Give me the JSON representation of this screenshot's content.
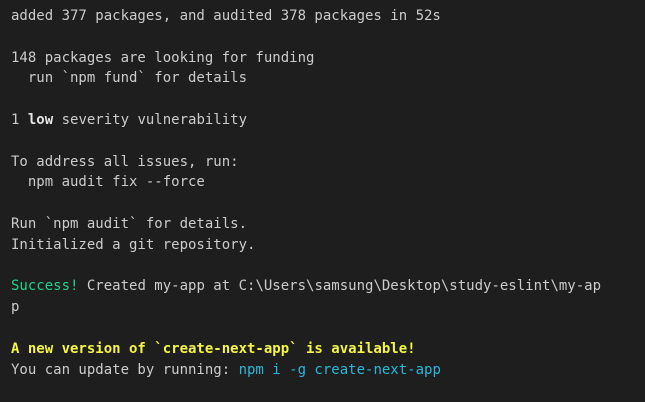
{
  "colors": {
    "background": "#1e1e1e",
    "foreground": "#cccccc",
    "success": "#23d18b",
    "warning": "#f5f543",
    "command": "#29b8db"
  },
  "lines": {
    "added": "added 377 packages, and audited 378 packages in 52s",
    "funding": "148 packages are looking for funding",
    "fund_hint": "  run `npm fund` for details",
    "vuln_count": "1 ",
    "vuln_level": "low",
    "vuln_rest": " severity vulnerability",
    "address": "To address all issues, run:",
    "fix_cmd": "  npm audit fix --force",
    "audit_hint": "Run `npm audit` for details.",
    "git_init": "Initialized a git repository.",
    "success_label": "Success!",
    "created_text": " Created my-app at C:\\Users\\samsung\\Desktop\\study-eslint\\my-ap",
    "created_wrap": "p",
    "new_version": "A new version of `create-next-app` is available!",
    "update_text": "You can update by running: ",
    "update_cmd": "npm i -g create-next-app"
  }
}
